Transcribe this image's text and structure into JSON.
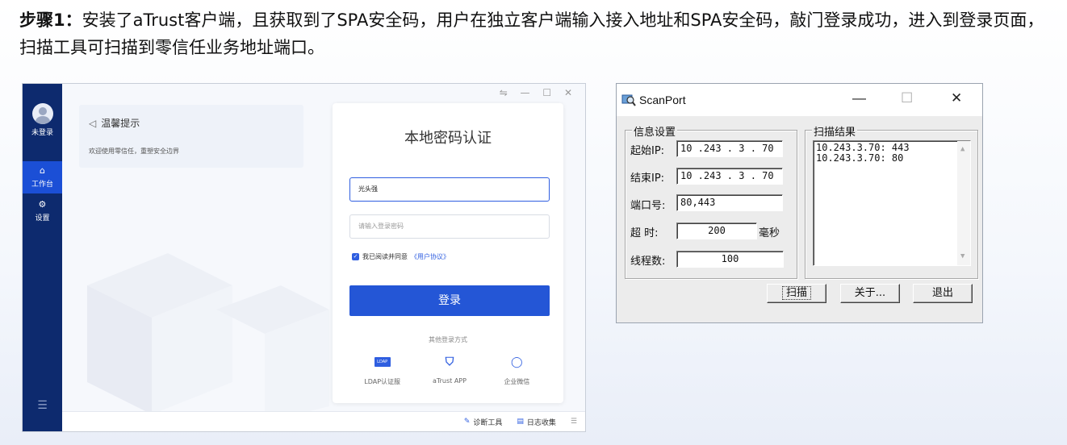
{
  "step": {
    "label": "步骤1：",
    "text": "安装了aTrust客户端，且获取到了SPA安全码，用户在独立客户端输入接入地址和SPA安全码，敲门登录成功，进入到登录页面，扫描工具可扫描到零信任业务地址端口。"
  },
  "atrust": {
    "sidebar": {
      "user_label": "未登录",
      "items": [
        {
          "label": "工作台",
          "icon": "home-icon",
          "active": true
        },
        {
          "label": "设置",
          "icon": "gear-icon",
          "active": false
        }
      ]
    },
    "window_controls": "⇋ — ☐ ✕",
    "tip": {
      "title": "温馨提示",
      "body": "欢迎使用零信任，重塑安全边界"
    },
    "login": {
      "title": "本地密码认证",
      "username_value": "光头强",
      "password_placeholder": "请输入登录密码",
      "agree_text": "我已阅读并同意",
      "agree_link": "《用户协议》",
      "submit_label": "登录",
      "other_title": "其他登录方式",
      "methods": [
        {
          "label": "LDAP认证服",
          "icon": "ldap-icon",
          "icon_text": "LDAP"
        },
        {
          "label": "aTrust APP",
          "icon": "shield-icon"
        },
        {
          "label": "企业微信",
          "icon": "wechat-icon"
        }
      ]
    },
    "bottom": {
      "diagnose": "诊断工具",
      "logs": "日志收集"
    }
  },
  "scanport": {
    "title": "ScanPort",
    "info_group": "信息设置",
    "result_group": "扫描结果",
    "fields": {
      "start_ip_label": "起始IP:",
      "start_ip_value": "10 .243 . 3 . 70",
      "end_ip_label": "结束IP:",
      "end_ip_value": "10 .243 . 3 . 70",
      "port_label": "端口号:",
      "port_value": "80,443",
      "timeout_label": "超  时:",
      "timeout_value": "200",
      "timeout_unit": "毫秒",
      "threads_label": "线程数:",
      "threads_value": "100"
    },
    "results": [
      "10.243.3.70: 443",
      "10.243.3.70: 80"
    ],
    "buttons": {
      "scan": "扫描",
      "about": "关于...",
      "exit": "退出"
    }
  }
}
